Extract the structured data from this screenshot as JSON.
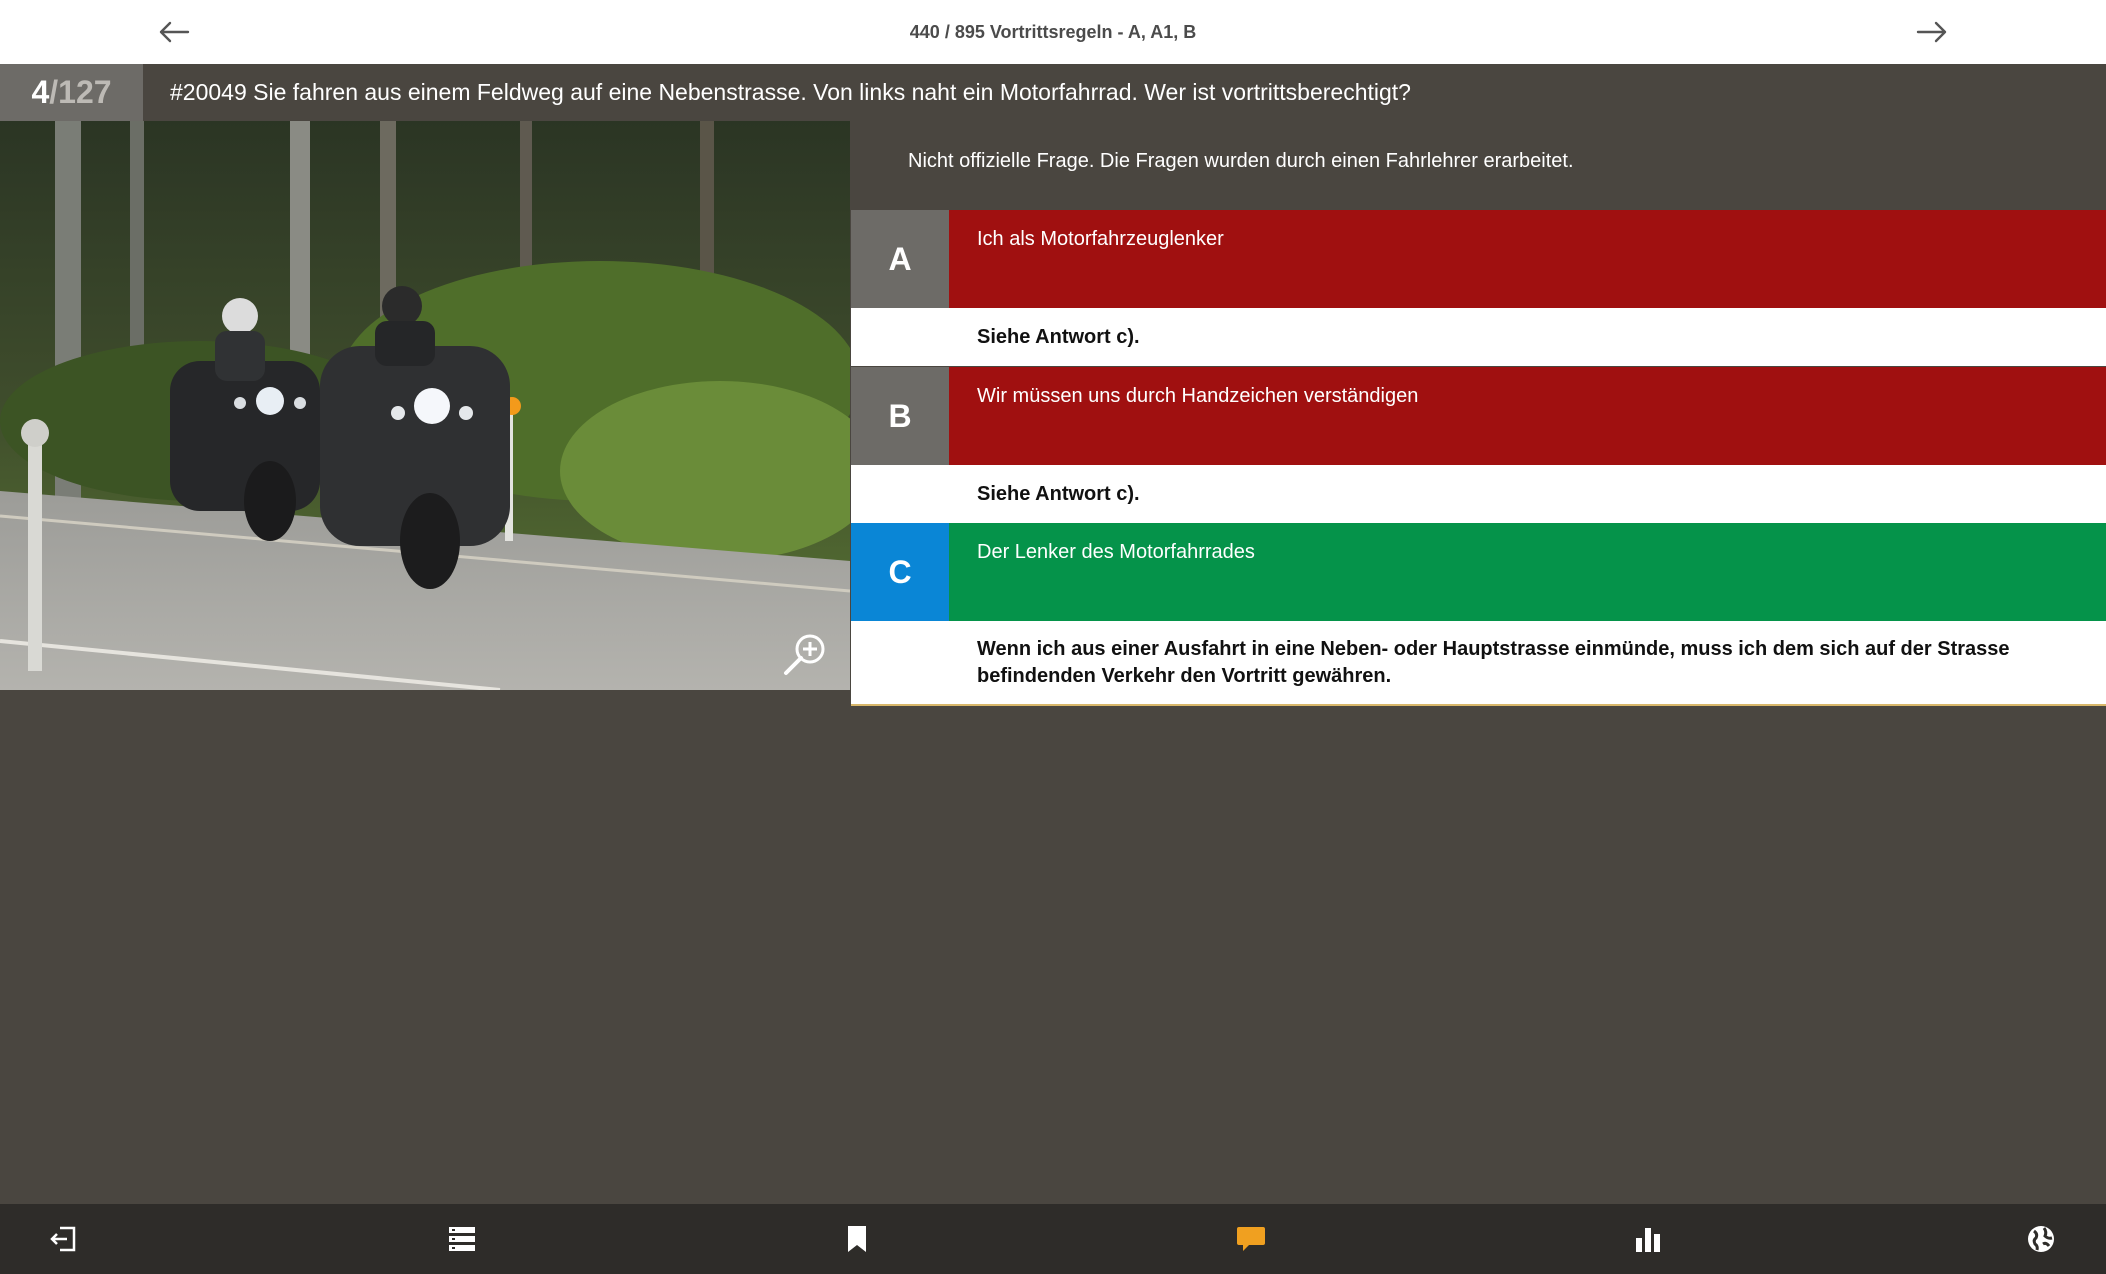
{
  "header": {
    "title": "440 / 895 Vortrittsregeln - A, A1, B",
    "back_icon": "arrow-left-icon",
    "forward_icon": "arrow-right-icon"
  },
  "question": {
    "current": "4",
    "total": "/127",
    "text": "#20049 Sie fahren aus einem Feldweg auf eine Nebenstrasse. Von links naht ein Motorfahrrad. Wer ist vortrittsberechtigt?",
    "note": "Nicht offizielle Frage. Die Fragen wurden durch einen Fahrlehrer erarbeitet."
  },
  "answers": [
    {
      "letter": "A",
      "text": "Ich als Motorfahrzeuglenker",
      "explanation": "Siehe Antwort c).",
      "letter_color": "#6d6b67",
      "row_color": "#a01010"
    },
    {
      "letter": "B",
      "text": "Wir müssen uns durch Handzeichen verständigen",
      "explanation": "Siehe Antwort c).",
      "letter_color": "#6d6b67",
      "row_color": "#a01010"
    },
    {
      "letter": "C",
      "text": "Der Lenker des Motorfahrrades",
      "explanation": "Wenn ich aus einer Ausfahrt in eine Neben- oder Hauptstrasse einmünde, muss ich dem sich auf der Strasse befindenden Verkehr den Vortritt gewähren.",
      "letter_color": "#0a86d6",
      "row_color": "#05934a"
    }
  ],
  "toolbar": {
    "items": [
      "exit-icon",
      "list-icon",
      "bookmark-icon",
      "comment-icon",
      "statistics-icon",
      "globe-icon"
    ],
    "accent_color": "#f0a020"
  }
}
